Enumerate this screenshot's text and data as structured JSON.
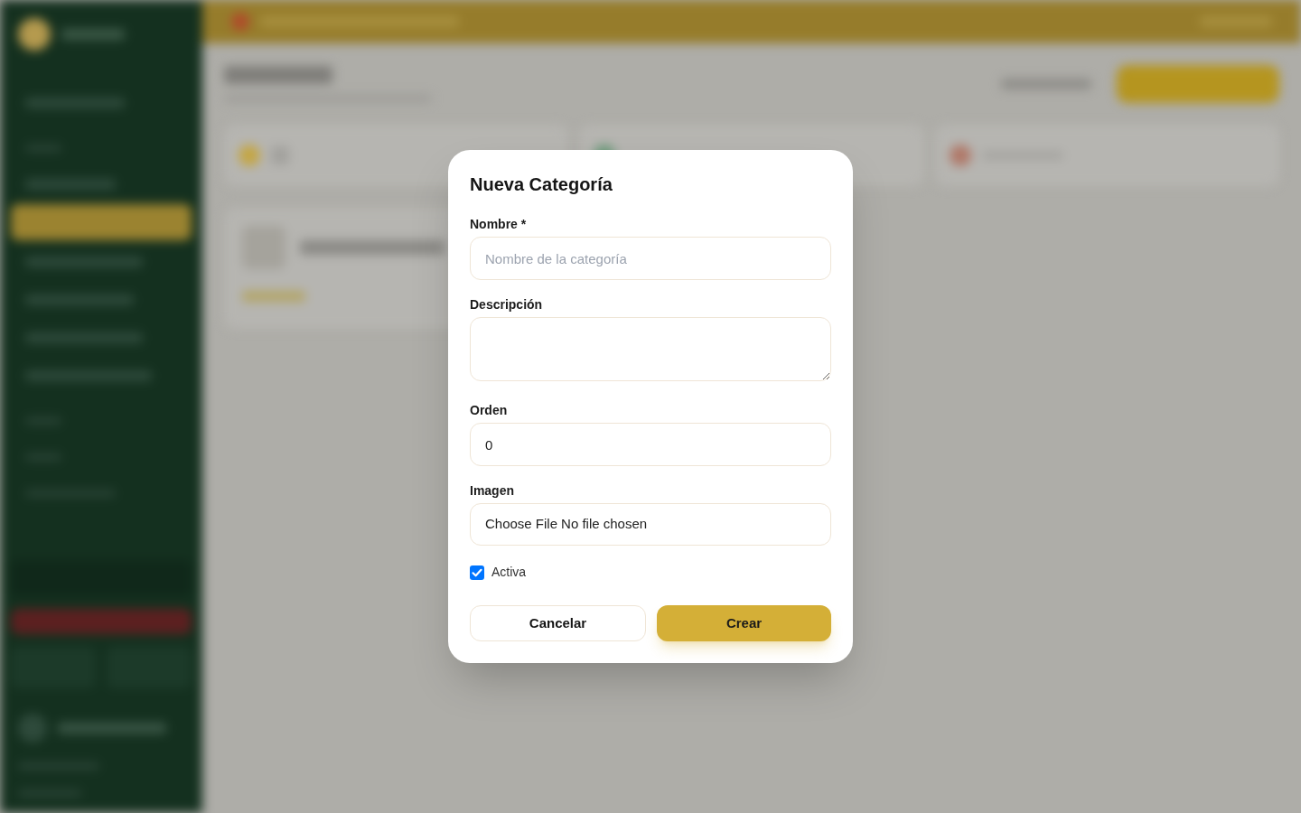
{
  "dialog": {
    "title": "Nueva Categoría",
    "fields": [
      {
        "kind": "text",
        "label": "Nombre *",
        "placeholder": "Nombre de la categoría"
      },
      {
        "kind": "textarea",
        "label": "Descripción"
      },
      {
        "kind": "number",
        "label": "Orden",
        "value": "0"
      },
      {
        "kind": "file",
        "label": "Imagen",
        "button_label": "Choose File",
        "status": "No file chosen"
      }
    ],
    "active_checkbox": {
      "label": "Activa",
      "checked": true
    },
    "buttons": [
      {
        "kind": "secondary",
        "label": "Cancelar"
      },
      {
        "kind": "primary",
        "label": "Crear"
      }
    ]
  }
}
